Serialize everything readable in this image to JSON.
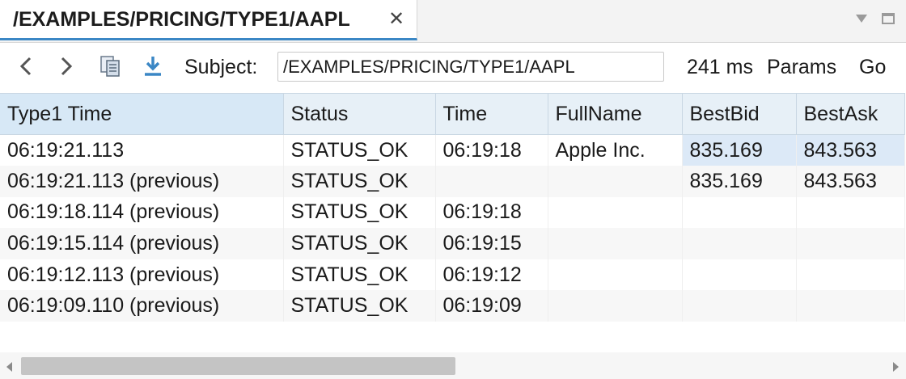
{
  "tab": {
    "title": "/EXAMPLES/PRICING/TYPE1/AAPL",
    "close_glyph": "✕"
  },
  "icons": {
    "back": "chevron-left-icon",
    "forward": "chevron-right-icon",
    "copy": "copy-icon",
    "download": "download-icon",
    "view_menu": "view-menu-icon",
    "maximize": "maximize-icon"
  },
  "toolbar": {
    "subject_label": "Subject:",
    "subject_value": "/EXAMPLES/PRICING/TYPE1/AAPL",
    "latency": "241 ms",
    "params_label": "Params",
    "go_label": "Go"
  },
  "table": {
    "columns": [
      "Type1 Time",
      "Status",
      "Time",
      "FullName",
      "BestBid",
      "BestAsk"
    ],
    "rows": [
      [
        "06:19:21.113",
        "STATUS_OK",
        "06:19:18",
        "Apple Inc.",
        "835.169",
        "843.563"
      ],
      [
        "06:19:21.113 (previous)",
        "STATUS_OK",
        "",
        "",
        "835.169",
        "843.563"
      ],
      [
        "06:19:18.114 (previous)",
        "STATUS_OK",
        "06:19:18",
        "",
        "",
        ""
      ],
      [
        "06:19:15.114 (previous)",
        "STATUS_OK",
        "06:19:15",
        "",
        "",
        ""
      ],
      [
        "06:19:12.113 (previous)",
        "STATUS_OK",
        "06:19:12",
        "",
        "",
        ""
      ],
      [
        "06:19:09.110 (previous)",
        "STATUS_OK",
        "06:19:09",
        "",
        "",
        ""
      ]
    ]
  },
  "colors": {
    "accent": "#3b87c5",
    "header_bg": "#e7f0f7",
    "highlight_cell": "#dce9f7",
    "icon_blue": "#3b87c5"
  }
}
